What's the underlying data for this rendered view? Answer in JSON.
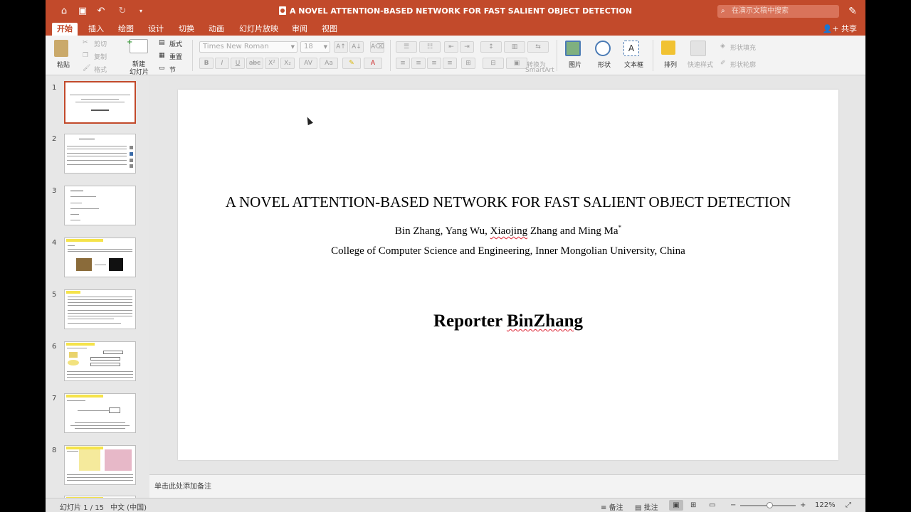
{
  "window": {
    "title": "A NOVEL ATTENTION-BASED NETWORK FOR FAST SALIENT OBJECT DETECTION",
    "search_placeholder": "在演示文稿中搜索"
  },
  "ribbon_tabs": [
    "开始",
    "插入",
    "绘图",
    "设计",
    "切换",
    "动画",
    "幻灯片放映",
    "审阅",
    "视图"
  ],
  "active_tab": "开始",
  "share_label": "共享",
  "ribbon": {
    "paste": "粘贴",
    "cut": "剪切",
    "copy": "复制",
    "format": "格式",
    "new_slide_line1": "新建",
    "new_slide_line2": "幻灯片",
    "layout": "版式",
    "reset": "重置",
    "section": "节",
    "font_name": "Times New Roman",
    "font_size": "18",
    "convert_line1": "转换为",
    "convert_line2": "SmartArt",
    "picture": "图片",
    "shape": "形状",
    "textbox": "文本框",
    "arrange": "排列",
    "quick_styles": "快速样式",
    "shape_fill": "形状填充",
    "shape_outline": "形状轮廓"
  },
  "slide": {
    "title": "A NOVEL ATTENTION-BASED NETWORK FOR FAST SALIENT OBJECT DETECTION",
    "authors": {
      "part1": "Bin Zhang, Yang Wu, ",
      "underlined": "Xiaojing",
      "part2": " Zhang and Ming Ma",
      "marker": "*"
    },
    "affiliation": "College of Computer Science and Engineering, Inner Mongolian University, China",
    "reporter": {
      "prefix": "Reporter ",
      "name": "BinZhang"
    }
  },
  "thumbnails": {
    "numbers": [
      "1",
      "2",
      "3",
      "4",
      "5",
      "6",
      "7",
      "8"
    ],
    "selected_index": 0
  },
  "notes_placeholder": "单击此处添加备注",
  "status": {
    "slide_counter": "幻灯片 1 / 15",
    "language": "中文 (中国)",
    "notes": "备注",
    "comments": "批注",
    "zoom": "122%",
    "zoom_fraction": 0.52
  },
  "colors": {
    "accent": "#c24a2b",
    "spellcheck": "#d22233"
  }
}
